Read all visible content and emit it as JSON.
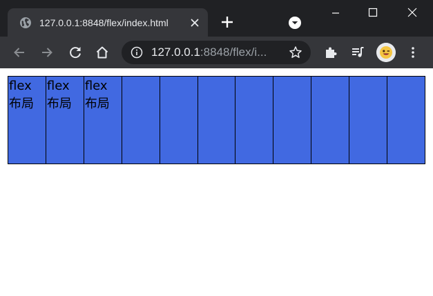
{
  "browser": {
    "tab": {
      "title": "127.0.0.1:8848/flex/index.html"
    },
    "address": {
      "host": "127.0.0.1",
      "rest": ":8848/flex/i..."
    }
  },
  "page": {
    "boxes": [
      {
        "line1": "flex",
        "line2": "布局"
      },
      {
        "line1": "flex",
        "line2": "布局"
      },
      {
        "line1": "flex",
        "line2": "布局"
      },
      {
        "line1": "",
        "line2": ""
      },
      {
        "line1": "",
        "line2": ""
      },
      {
        "line1": "",
        "line2": ""
      },
      {
        "line1": "",
        "line2": ""
      },
      {
        "line1": "",
        "line2": ""
      },
      {
        "line1": "",
        "line2": ""
      },
      {
        "line1": "",
        "line2": ""
      },
      {
        "line1": "",
        "line2": ""
      }
    ],
    "colors": {
      "box_fill": "#4169e1",
      "box_border": "#000000"
    }
  }
}
